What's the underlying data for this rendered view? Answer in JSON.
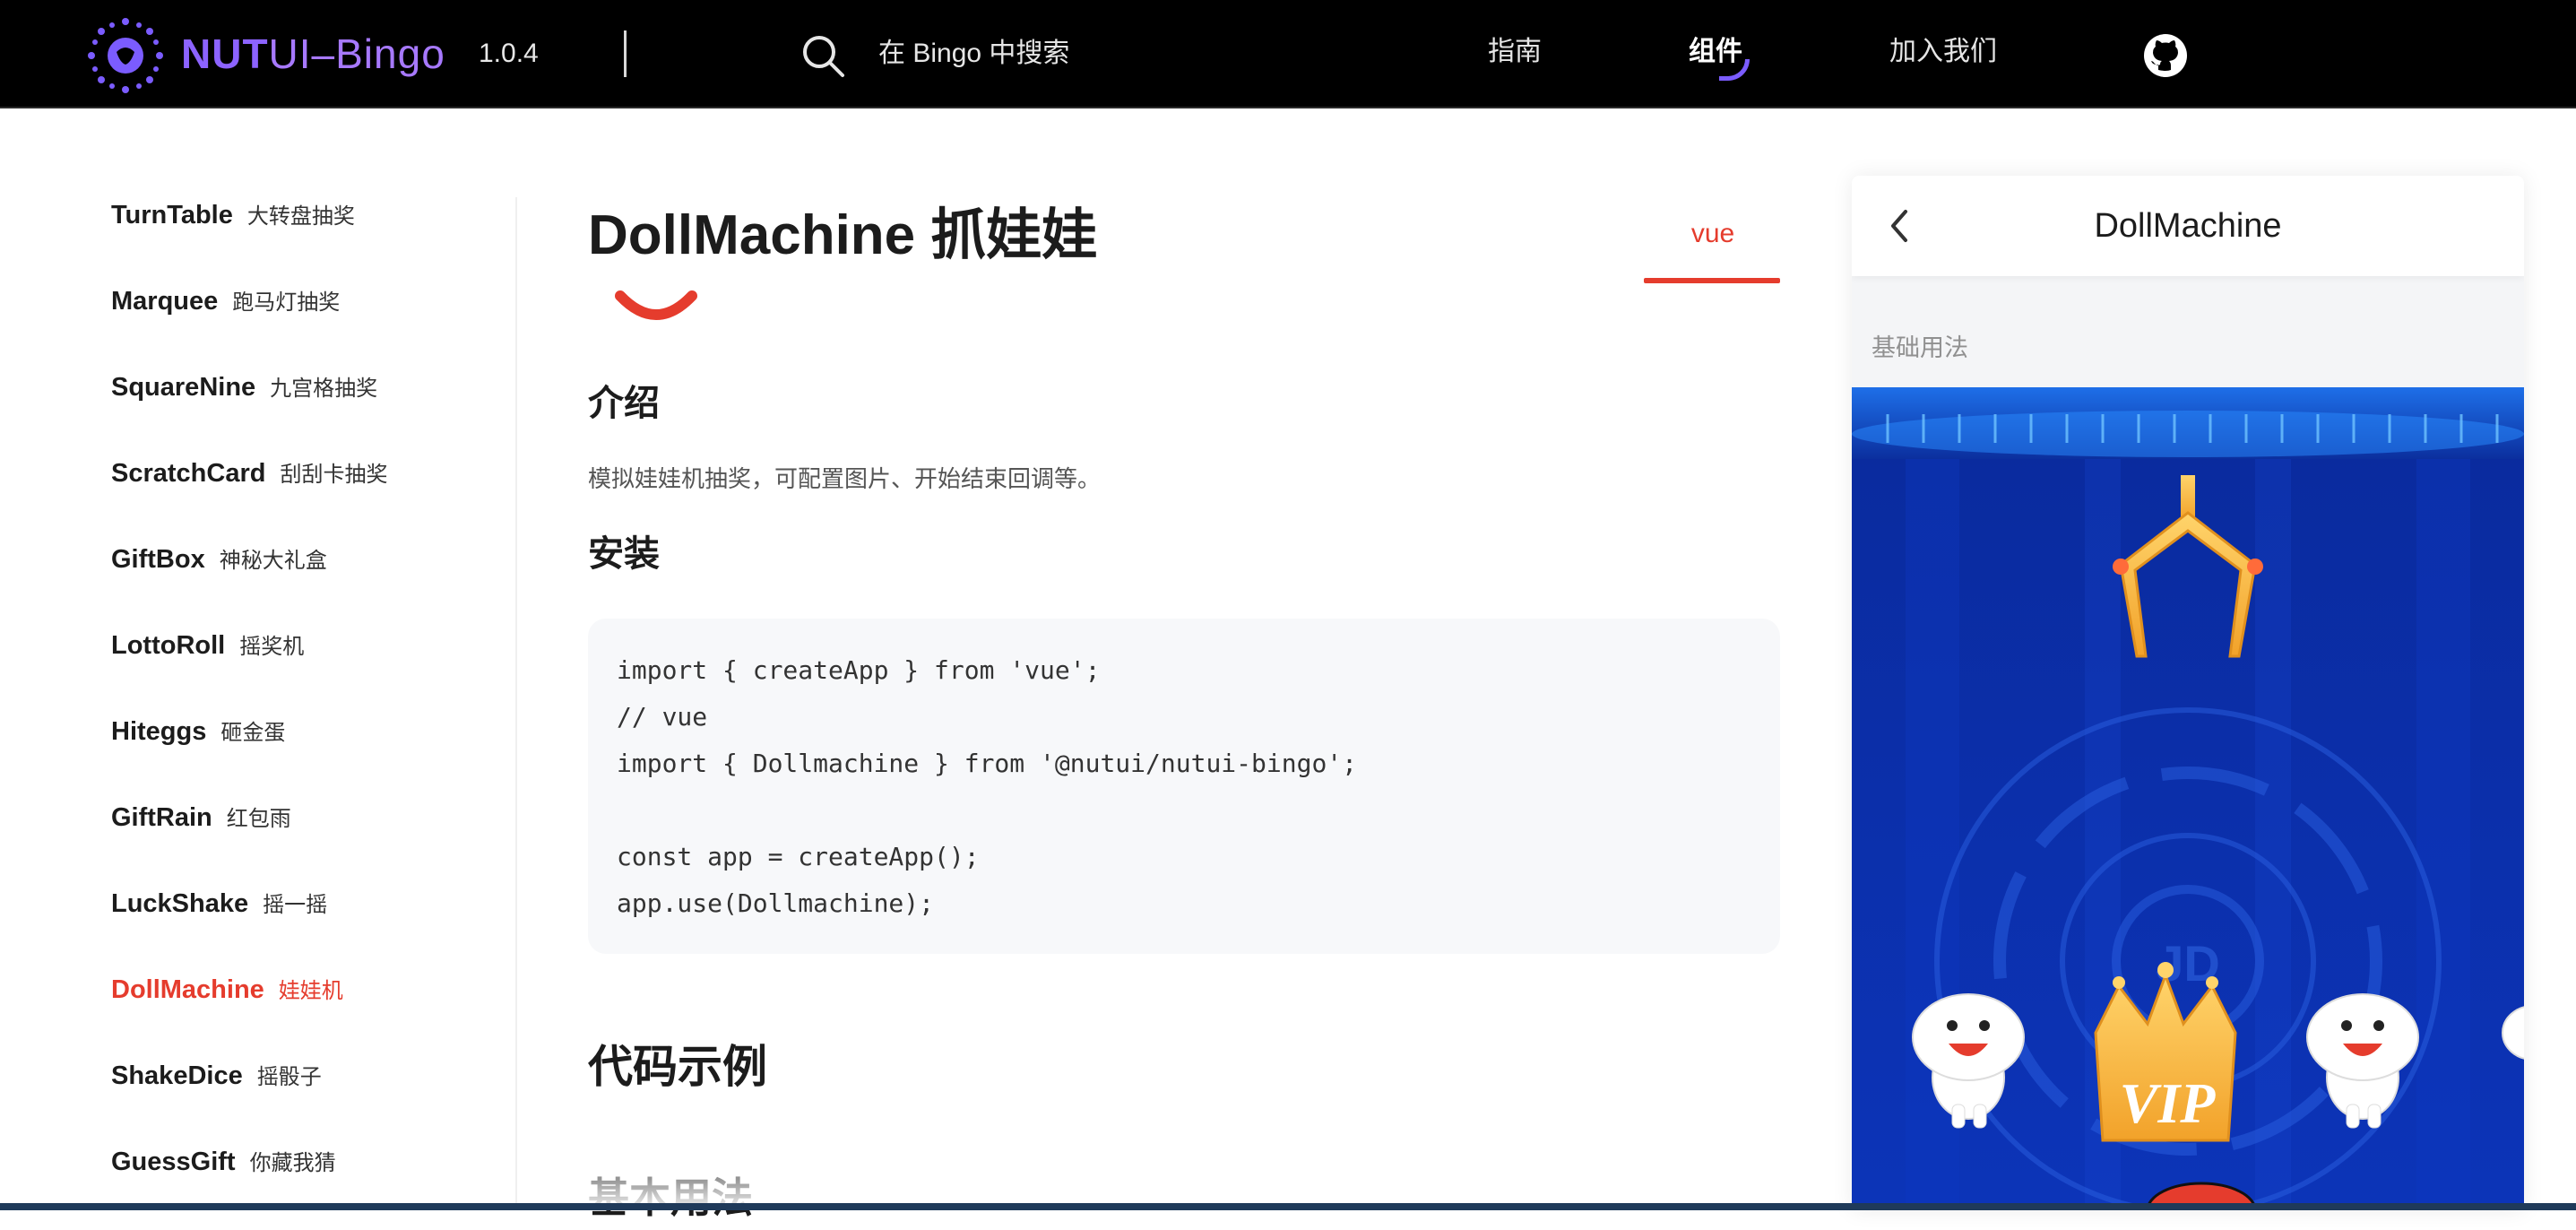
{
  "header": {
    "brand_part1": "NUT",
    "brand_part2": "UI",
    "brand_part3": "–Bingo",
    "version": "1.0.4",
    "search_placeholder": "在 Bingo 中搜索",
    "nav": [
      {
        "label": "指南",
        "active": false
      },
      {
        "label": "组件",
        "active": true
      },
      {
        "label": "加入我们",
        "active": false
      }
    ],
    "icons": {
      "logo": "nutui-logo-icon",
      "search": "search-icon",
      "github": "github-icon"
    },
    "accent_color": "#7b5cff"
  },
  "sidebar": {
    "items": [
      {
        "en": "TurnTable",
        "zh": "大转盘抽奖",
        "active": false
      },
      {
        "en": "Marquee",
        "zh": "跑马灯抽奖",
        "active": false
      },
      {
        "en": "SquareNine",
        "zh": "九宫格抽奖",
        "active": false
      },
      {
        "en": "ScratchCard",
        "zh": "刮刮卡抽奖",
        "active": false
      },
      {
        "en": "GiftBox",
        "zh": "神秘大礼盒",
        "active": false
      },
      {
        "en": "LottoRoll",
        "zh": "摇奖机",
        "active": false
      },
      {
        "en": "Hiteggs",
        "zh": "砸金蛋",
        "active": false
      },
      {
        "en": "GiftRain",
        "zh": "红包雨",
        "active": false
      },
      {
        "en": "LuckShake",
        "zh": "摇一摇",
        "active": false
      },
      {
        "en": "DollMachine",
        "zh": "娃娃机",
        "active": true
      },
      {
        "en": "ShakeDice",
        "zh": "摇骰子",
        "active": false
      },
      {
        "en": "GuessGift",
        "zh": "你藏我猜",
        "active": false
      }
    ],
    "active_color": "#e53c2d"
  },
  "doc": {
    "title": "DollMachine 抓娃娃",
    "tab": "vue",
    "intro_heading": "介绍",
    "intro_text": "模拟娃娃机抽奖，可配置图片、开始结束回调等。",
    "install_heading": "安装",
    "code_lines": [
      "import { createApp } from 'vue';",
      "// vue",
      "import { Dollmachine } from '@nutui/nutui-bingo';",
      "",
      "const app = createApp();",
      "app.use(Dollmachine);"
    ],
    "example_heading": "代码示例",
    "basic_heading": "基本用法"
  },
  "phone": {
    "title": "DollMachine",
    "section": "基础用法",
    "icons": {
      "back": "chevron-left-icon",
      "claw": "claw-icon",
      "mascot": "jd-dog-mascot-icon",
      "crown": "vip-crown-icon"
    },
    "crown_text": "VIP",
    "watermark_text": "JD"
  }
}
